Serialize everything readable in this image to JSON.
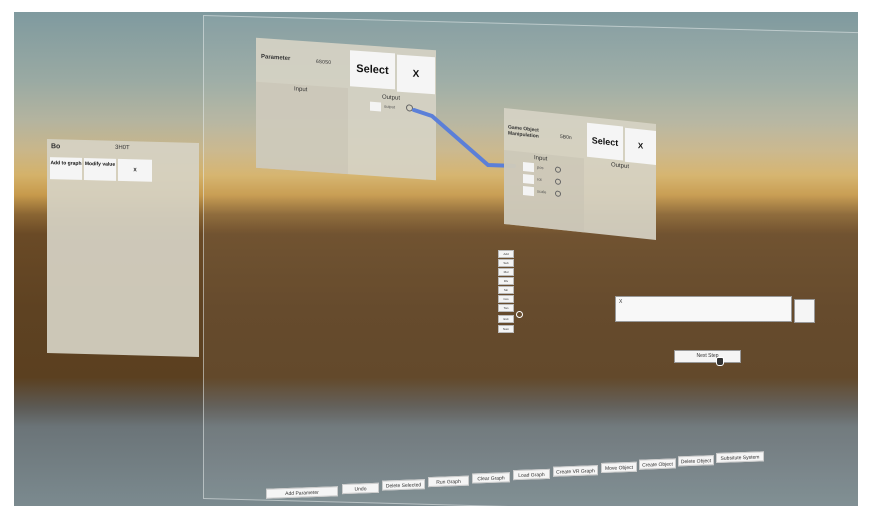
{
  "left_panel": {
    "name": "Bo",
    "id": "3H0T",
    "buttons": [
      "Add to graph",
      "Modify value",
      "X"
    ]
  },
  "param_node": {
    "title": "Parameter",
    "id": "6S0S0",
    "select_label": "Select",
    "close_label": "X",
    "input_label": "Input",
    "output_label": "Output",
    "output_port": "output"
  },
  "game_node": {
    "title": "Game Object Manipulation",
    "id": "5B0n",
    "select_label": "Select",
    "close_label": "X",
    "input_label": "Input",
    "output_label": "Output",
    "input_ports": [
      "pos",
      "rot",
      "scale"
    ]
  },
  "stack_buttons": [
    "Add",
    "Sub",
    "Mul",
    "Div",
    "Sin",
    "Cos",
    "Tan",
    "Exit",
    "Num"
  ],
  "text_field": {
    "value": "X"
  },
  "next_step_label": "Next Step",
  "toolbar": [
    "Add Parameter",
    "Undo",
    "Delete Selected",
    "Run Graph",
    "Clear Graph",
    "Load Graph",
    "Create VR Graph",
    "Move Object",
    "Create Object",
    "Delete Object",
    "Subsitute System"
  ],
  "colors": {
    "connector": "#5b7fd8",
    "panel": "#d6d2c4",
    "button": "#f5f5f5"
  }
}
